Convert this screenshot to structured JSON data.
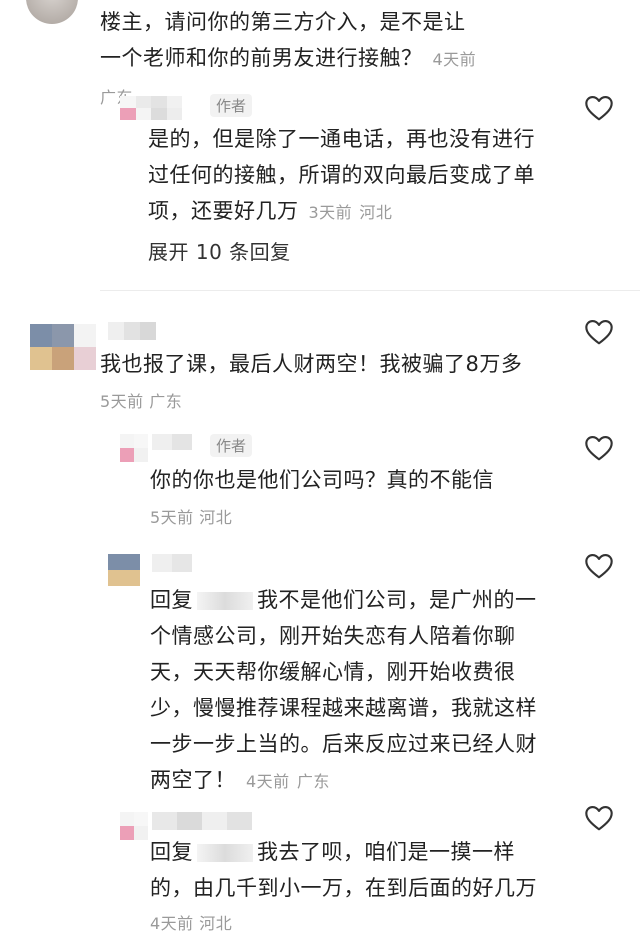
{
  "comments": [
    {
      "text": "楼主，请问你的第三方介入，是不是让一个老师和你的前男友进行接触？",
      "time": "4天前",
      "location": "广东",
      "replies": [
        {
          "badge": "作者",
          "text": "是的，但是除了一通电话，再也没有进行过任何的接触，所谓的双向最后变成了单项，还要好几万",
          "time": "3天前",
          "location": "河北",
          "expand_label": "展开 10 条回复"
        }
      ]
    },
    {
      "text": "我也报了课，最后人财两空！我被骗了8万多",
      "time": "5天前",
      "location": "广东",
      "replies": [
        {
          "badge": "作者",
          "text": "你的你也是他们公司吗？真的不能信",
          "time": "5天前",
          "location": "河北"
        },
        {
          "prefix": "回复",
          "text": "我不是他们公司，是广州的一个情感公司，刚开始失恋有人陪着你聊天，天天帮你缓解心情，刚开始收费很少，慢慢推荐课程越来越离谱，我就这样一步一步上当的。后来反应过来已经人财两空了！",
          "time": "4天前",
          "location": "广东"
        },
        {
          "prefix": "回复",
          "text": "我去了呗，咱们是一摸一样的，由几千到小一万，在到后面的好几万",
          "time": "4天前",
          "location": "河北"
        }
      ]
    }
  ],
  "icons": {
    "like": "heart-outline-icon"
  },
  "colors": {
    "text": "#222222",
    "meta": "#9a9a9a",
    "divider": "#ececec"
  }
}
